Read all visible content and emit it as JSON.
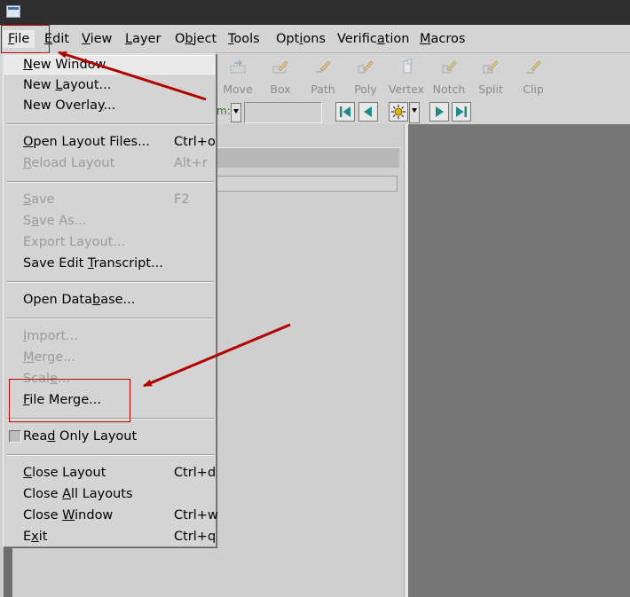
{
  "menubar": {
    "items": [
      {
        "pre": "",
        "key": "F",
        "post": "ile"
      },
      {
        "pre": "",
        "key": "E",
        "post": "dit"
      },
      {
        "pre": "",
        "key": "V",
        "post": "iew"
      },
      {
        "pre": "",
        "key": "L",
        "post": "ayer"
      },
      {
        "pre": "O",
        "key": "b",
        "post": "ject"
      },
      {
        "pre": "",
        "key": "T",
        "post": "ools"
      },
      {
        "pre": "Opt",
        "key": "i",
        "post": "ons"
      },
      {
        "pre": "Verific",
        "key": "a",
        "post": "tion"
      },
      {
        "pre": "",
        "key": "M",
        "post": "acros"
      }
    ]
  },
  "toolbar": {
    "tools": [
      {
        "label": "Move",
        "icon": "move-icon"
      },
      {
        "label": "Box",
        "icon": "box-icon"
      },
      {
        "label": "Path",
        "icon": "path-icon"
      },
      {
        "label": "Poly",
        "icon": "poly-icon"
      },
      {
        "label": "Vertex",
        "icon": "vertex-icon"
      },
      {
        "label": "Notch",
        "icon": "notch-icon"
      },
      {
        "label": "Split",
        "icon": "split-icon"
      },
      {
        "label": "Clip",
        "icon": "clip-icon"
      }
    ],
    "zoom_label": "m:",
    "zoom_value": ""
  },
  "file_menu": {
    "items": [
      {
        "pre": "",
        "key": "N",
        "post": "ew Window",
        "shortcut": ""
      },
      {
        "pre": "New ",
        "key": "L",
        "post": "ayout...",
        "shortcut": ""
      },
      {
        "pre": "New Overla",
        "key": "y",
        "post": "...",
        "shortcut": ""
      },
      {
        "pre": "",
        "key": "O",
        "post": "pen Layout Files...",
        "shortcut": "Ctrl+o"
      },
      {
        "pre": "",
        "key": "R",
        "post": "eload Layout",
        "shortcut": "Alt+r"
      },
      {
        "pre": "",
        "key": "S",
        "post": "ave",
        "shortcut": "F2"
      },
      {
        "pre": "S",
        "key": "a",
        "post": "ve As...",
        "shortcut": ""
      },
      {
        "pre": "Export Layout...",
        "key": "",
        "post": "",
        "shortcut": ""
      },
      {
        "pre": "Save Edit ",
        "key": "T",
        "post": "ranscript...",
        "shortcut": ""
      },
      {
        "pre": "Open Data",
        "key": "b",
        "post": "ase...",
        "shortcut": ""
      },
      {
        "pre": "",
        "key": "I",
        "post": "mport...",
        "shortcut": ""
      },
      {
        "pre": "",
        "key": "M",
        "post": "erge...",
        "shortcut": ""
      },
      {
        "pre": "Scal",
        "key": "e",
        "post": "...",
        "shortcut": ""
      },
      {
        "pre": "",
        "key": "F",
        "post": "ile Merge...",
        "shortcut": ""
      },
      {
        "pre": "Rea",
        "key": "d",
        "post": " Only Layout",
        "shortcut": ""
      },
      {
        "pre": "",
        "key": "C",
        "post": "lose Layout",
        "shortcut": "Ctrl+d"
      },
      {
        "pre": "Close ",
        "key": "A",
        "post": "ll Layouts",
        "shortcut": ""
      },
      {
        "pre": "Close ",
        "key": "W",
        "post": "indow",
        "shortcut": "Ctrl+w"
      },
      {
        "pre": "E",
        "key": "x",
        "post": "it",
        "shortcut": "Ctrl+q"
      }
    ]
  },
  "colors": {
    "annotation_red": "#c00000",
    "menu_bg": "#d4d4d4",
    "canvas_bg": "#777777",
    "disabled_text": "#9a9a9a"
  }
}
